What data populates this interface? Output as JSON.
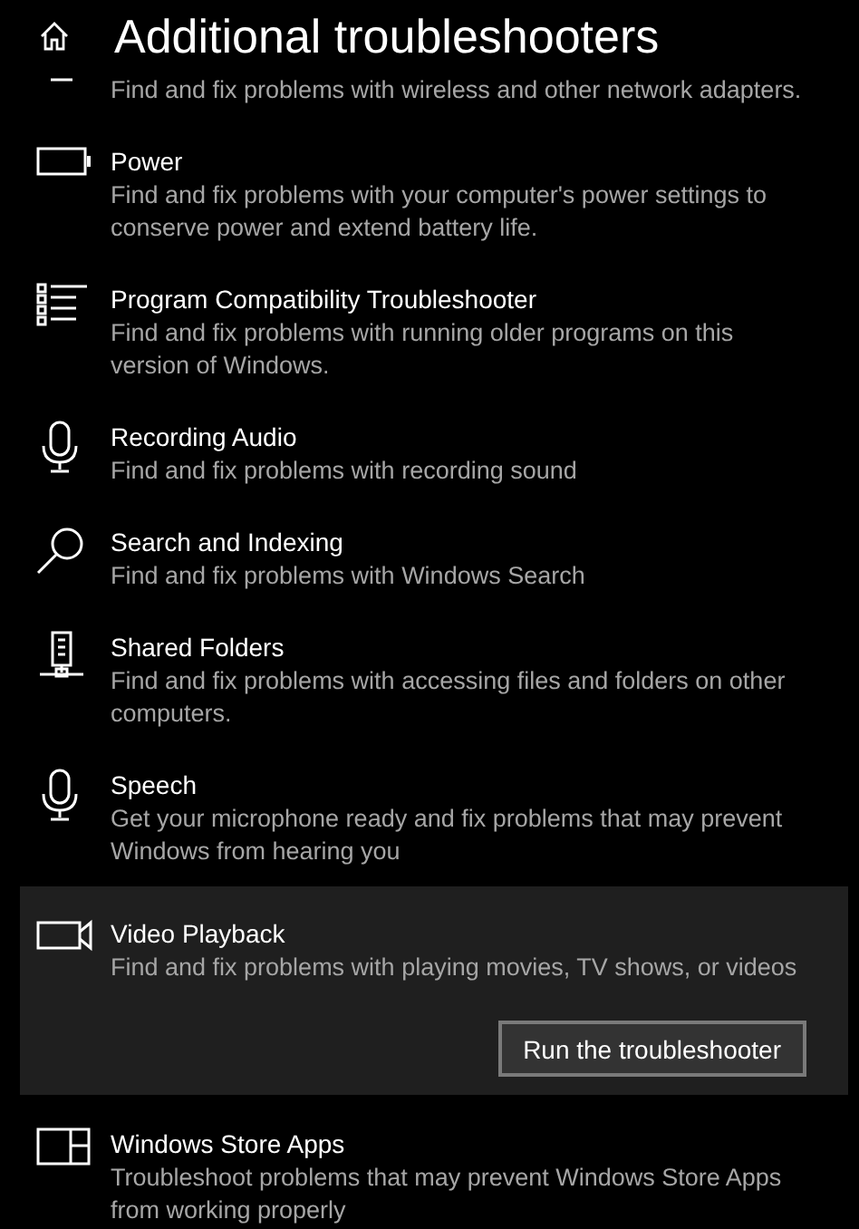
{
  "header": {
    "title": "Additional troubleshooters"
  },
  "troubleshooters": [
    {
      "description": "Find and fix problems with wireless and other network adapters.",
      "selected": false
    },
    {
      "title": "Power",
      "description": "Find and fix problems with your computer's power settings to conserve power and extend battery life.",
      "selected": false
    },
    {
      "title": "Program Compatibility Troubleshooter",
      "description": "Find and fix problems with running older programs on this version of Windows.",
      "selected": false
    },
    {
      "title": "Recording Audio",
      "description": "Find and fix problems with recording sound",
      "selected": false
    },
    {
      "title": "Search and Indexing",
      "description": "Find and fix problems with Windows Search",
      "selected": false
    },
    {
      "title": "Shared Folders",
      "description": "Find and fix problems with accessing files and folders on other computers.",
      "selected": false
    },
    {
      "title": "Speech",
      "description": "Get your microphone ready and fix problems that may prevent Windows from hearing you",
      "selected": false
    },
    {
      "title": "Video Playback",
      "description": "Find and fix problems with playing movies, TV shows, or videos",
      "selected": true,
      "action": "Run the troubleshooter"
    },
    {
      "title": "Windows Store Apps",
      "description": "Troubleshoot problems that may prevent Windows Store Apps from working properly",
      "selected": false
    }
  ]
}
